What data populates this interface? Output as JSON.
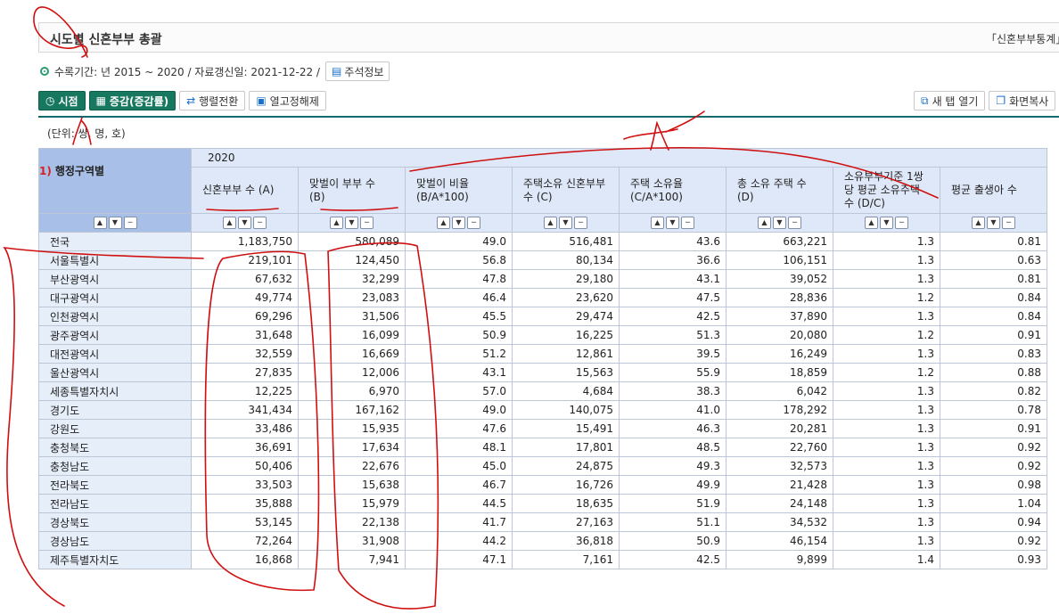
{
  "title": "시도별 신혼부부 총괄",
  "source": "「신혼부부통계」",
  "meta": {
    "period": "수록기간: 년 2015 ~ 2020 / 자료갱신일: 2021-12-22 /",
    "note_button": "주석정보"
  },
  "toolbar": {
    "time_label": "시점",
    "change_label": "증감(증감률)",
    "pivot_label": "행렬전환",
    "unfreeze_label": "열고정해제",
    "new_tab_label": "새 탭 열기",
    "copy_label": "화면복사"
  },
  "unit": "(단위: 쌍, 명, 호)",
  "table": {
    "row_header_num": "1)",
    "row_header": "행정구역별",
    "year": "2020",
    "columns": [
      "신혼부부 수 (A)",
      "맞벌이 부부 수 (B)",
      "맞벌이 비율 (B/A*100)",
      "주택소유 신혼부부 수 (C)",
      "주택 소유율 (C/A*100)",
      "총 소유 주택 수 (D)",
      "소유부부기준 1쌍당 평균 소유주택 수 (D/C)",
      "평균 출생아 수"
    ],
    "rows": [
      {
        "name": "전국",
        "values": [
          "1,183,750",
          "580,089",
          "49.0",
          "516,481",
          "43.6",
          "663,221",
          "1.3",
          "0.81"
        ]
      },
      {
        "name": "서울특별시",
        "values": [
          "219,101",
          "124,450",
          "56.8",
          "80,134",
          "36.6",
          "106,151",
          "1.3",
          "0.63"
        ]
      },
      {
        "name": "부산광역시",
        "values": [
          "67,632",
          "32,299",
          "47.8",
          "29,180",
          "43.1",
          "39,052",
          "1.3",
          "0.81"
        ]
      },
      {
        "name": "대구광역시",
        "values": [
          "49,774",
          "23,083",
          "46.4",
          "23,620",
          "47.5",
          "28,836",
          "1.2",
          "0.84"
        ]
      },
      {
        "name": "인천광역시",
        "values": [
          "69,296",
          "31,506",
          "45.5",
          "29,474",
          "42.5",
          "37,890",
          "1.3",
          "0.84"
        ]
      },
      {
        "name": "광주광역시",
        "values": [
          "31,648",
          "16,099",
          "50.9",
          "16,225",
          "51.3",
          "20,080",
          "1.2",
          "0.91"
        ]
      },
      {
        "name": "대전광역시",
        "values": [
          "32,559",
          "16,669",
          "51.2",
          "12,861",
          "39.5",
          "16,249",
          "1.3",
          "0.83"
        ]
      },
      {
        "name": "울산광역시",
        "values": [
          "27,835",
          "12,006",
          "43.1",
          "15,563",
          "55.9",
          "18,859",
          "1.2",
          "0.88"
        ]
      },
      {
        "name": "세종특별자치시",
        "values": [
          "12,225",
          "6,970",
          "57.0",
          "4,684",
          "38.3",
          "6,042",
          "1.3",
          "0.82"
        ]
      },
      {
        "name": "경기도",
        "values": [
          "341,434",
          "167,162",
          "49.0",
          "140,075",
          "41.0",
          "178,292",
          "1.3",
          "0.78"
        ]
      },
      {
        "name": "강원도",
        "values": [
          "33,486",
          "15,935",
          "47.6",
          "15,491",
          "46.3",
          "20,281",
          "1.3",
          "0.91"
        ]
      },
      {
        "name": "충청북도",
        "values": [
          "36,691",
          "17,634",
          "48.1",
          "17,801",
          "48.5",
          "22,760",
          "1.3",
          "0.92"
        ]
      },
      {
        "name": "충청남도",
        "values": [
          "50,406",
          "22,676",
          "45.0",
          "24,875",
          "49.3",
          "32,573",
          "1.3",
          "0.92"
        ]
      },
      {
        "name": "전라북도",
        "values": [
          "33,503",
          "15,638",
          "46.7",
          "16,726",
          "49.9",
          "21,428",
          "1.3",
          "0.98"
        ]
      },
      {
        "name": "전라남도",
        "values": [
          "35,888",
          "15,979",
          "44.5",
          "18,635",
          "51.9",
          "24,148",
          "1.3",
          "1.04"
        ]
      },
      {
        "name": "경상북도",
        "values": [
          "53,145",
          "22,138",
          "41.7",
          "27,163",
          "51.1",
          "34,532",
          "1.3",
          "0.94"
        ]
      },
      {
        "name": "경상남도",
        "values": [
          "72,264",
          "31,908",
          "44.2",
          "36,818",
          "50.9",
          "46,154",
          "1.3",
          "0.92"
        ]
      },
      {
        "name": "제주특별자치도",
        "values": [
          "16,868",
          "7,941",
          "47.1",
          "7,161",
          "42.5",
          "9,899",
          "1.4",
          "0.93"
        ]
      }
    ]
  },
  "colors": {
    "accent_green": "#17775f",
    "header_blue": "#dfe8f8",
    "row_header_blue": "#a8c0e8",
    "annotation_red": "#d01010"
  }
}
